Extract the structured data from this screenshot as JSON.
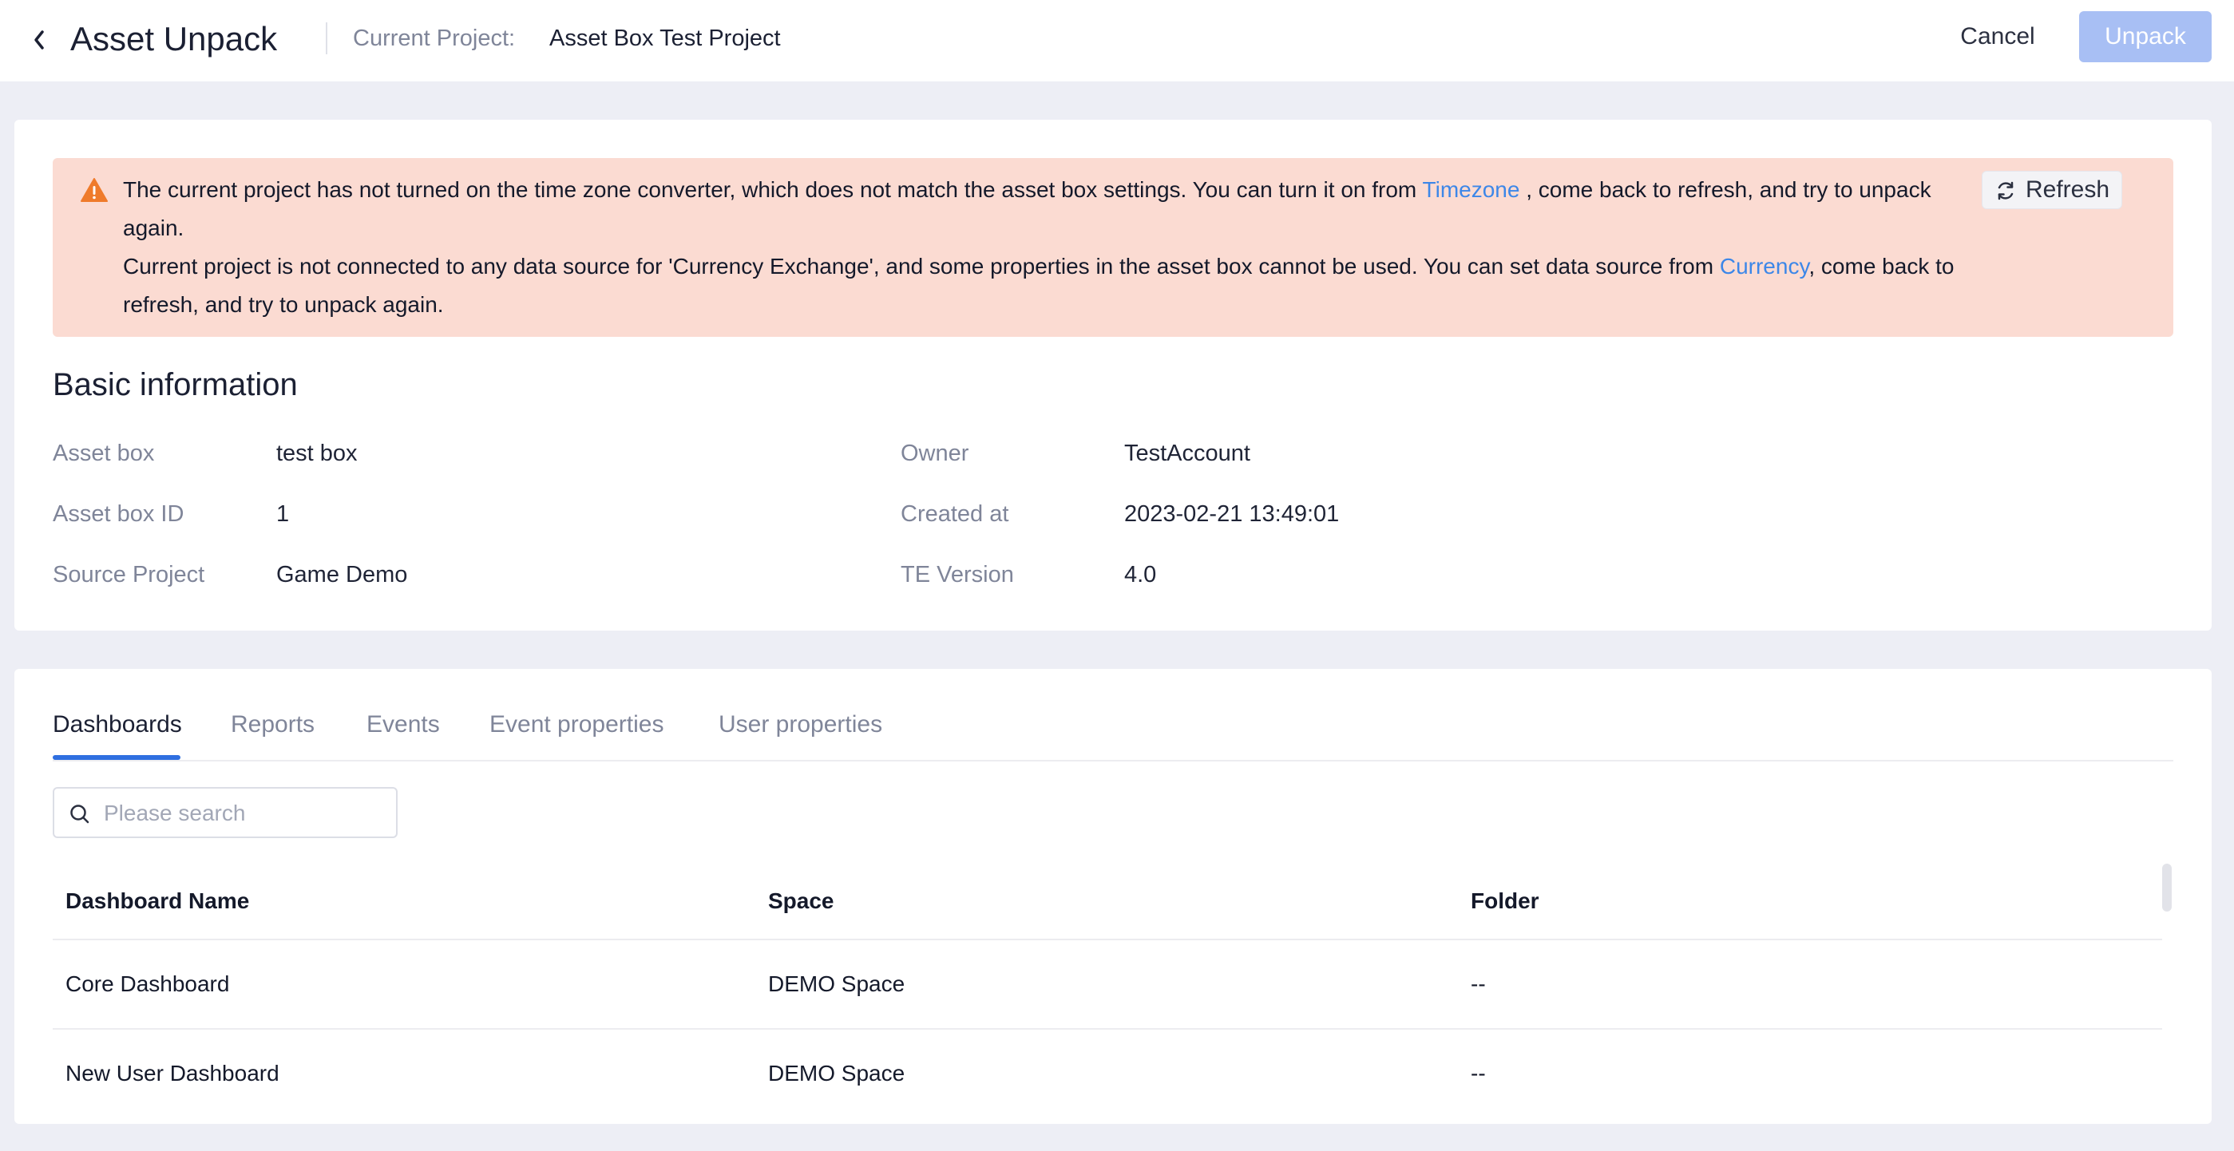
{
  "header": {
    "title": "Asset Unpack",
    "current_project_label": "Current Project:",
    "current_project_value": "Asset Box Test Project",
    "cancel_label": "Cancel",
    "unpack_label": "Unpack"
  },
  "alert": {
    "line1_before": "The current project has not turned on the time zone converter, which does not match the asset box settings. You can turn it on from ",
    "line1_link": "Timezone",
    "line1_after": " , come back to refresh, and try to unpack again.",
    "line2_before": "Current project is not connected to any data source for 'Currency Exchange', and some properties in the asset box cannot be used. You can set data source from ",
    "line2_link": "Currency",
    "line2_after": ", come back to refresh, and try to unpack again.",
    "refresh_label": "Refresh"
  },
  "basic_info": {
    "title": "Basic information",
    "asset_box_label": "Asset box",
    "asset_box_value": "test box",
    "asset_box_id_label": "Asset box ID",
    "asset_box_id_value": "1",
    "source_project_label": "Source Project",
    "source_project_value": "Game Demo",
    "owner_label": "Owner",
    "owner_value": "TestAccount",
    "created_at_label": "Created at",
    "created_at_value": "2023-02-21 13:49:01",
    "te_version_label": "TE Version",
    "te_version_value": "4.0"
  },
  "tabs": [
    "Dashboards",
    "Reports",
    "Events",
    "Event properties",
    "User properties"
  ],
  "search": {
    "placeholder": "Please search"
  },
  "table": {
    "columns": [
      "Dashboard Name",
      "Space",
      "Folder"
    ],
    "rows": [
      [
        "Core Dashboard",
        "DEMO Space",
        "--"
      ],
      [
        "New User Dashboard",
        "DEMO Space",
        "--"
      ]
    ]
  },
  "colors": {
    "accent": "#2f6fe0",
    "link": "#3d87e8",
    "alert_bg": "#fbdbd2",
    "warning_icon": "#ef7b2b",
    "unpack_disabled": "#a8bff4"
  }
}
